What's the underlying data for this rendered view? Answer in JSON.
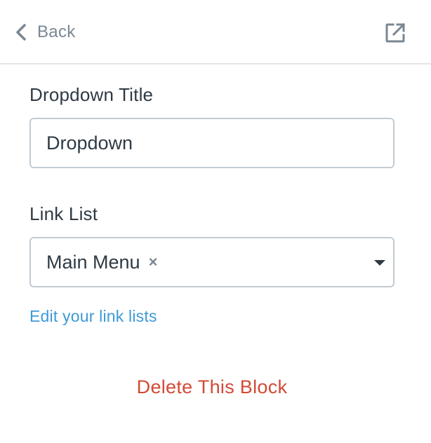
{
  "header": {
    "back_label": "Back",
    "icons": {
      "back": "chevron-left-icon",
      "open": "external-link-icon"
    },
    "colors": {
      "icon": "#7b8792",
      "divider": "#e3e6e9"
    }
  },
  "form": {
    "title_field": {
      "label": "Dropdown Title",
      "value": "Dropdown"
    },
    "link_list_field": {
      "label": "Link List",
      "selected_value": "Main Menu",
      "remove_glyph": "×"
    },
    "edit_link_label": "Edit your link lists",
    "delete_label": "Delete This Block"
  },
  "colors": {
    "text": "#2f3a44",
    "link": "#3d9ad8",
    "danger": "#d24a35",
    "input_border": "#c2cbd3"
  }
}
